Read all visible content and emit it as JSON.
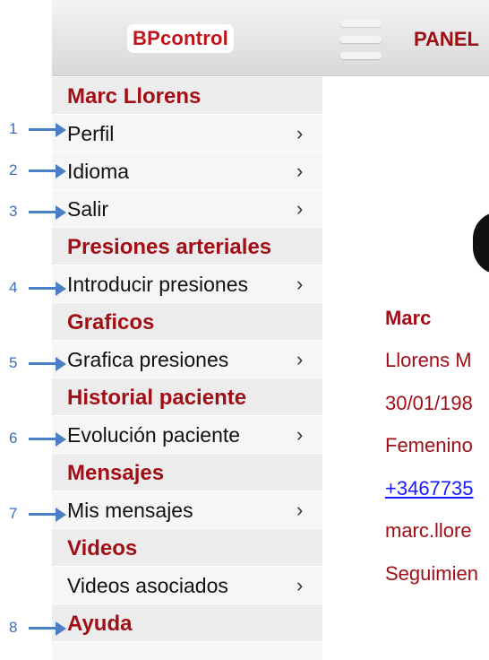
{
  "header": {
    "logo_bp": "BP",
    "logo_control": "control",
    "panel_label": "PANEL"
  },
  "menu": {
    "user_name": "Marc Llorens",
    "perfil": "Perfil",
    "idioma": "Idioma",
    "salir": "Salir",
    "sec_presiones": "Presiones arteriales",
    "introducir": "Introducir presiones",
    "sec_graficos": "Graficos",
    "grafica": "Grafica presiones",
    "sec_historial": "Historial paciente",
    "evolucion": "Evolución paciente",
    "sec_mensajes": "Mensajes",
    "mis_mensajes": "Mis mensajes",
    "sec_videos": "Videos",
    "videos_asociados": "Videos asociados",
    "sec_ayuda": "Ayuda",
    "chevron": "›"
  },
  "content": {
    "name": "Marc",
    "surname": "Llorens M",
    "birthdate": "30/01/198",
    "gender": "Femenino",
    "phone": "+3467735",
    "email": "marc.llore",
    "status": "Seguimien"
  },
  "annotations": [
    "1",
    "2",
    "3",
    "4",
    "5",
    "6",
    "7",
    "8"
  ],
  "colors": {
    "brand_red": "#a20e16",
    "annotation_blue": "#4a7fc6",
    "link_blue": "#1a1aff"
  }
}
